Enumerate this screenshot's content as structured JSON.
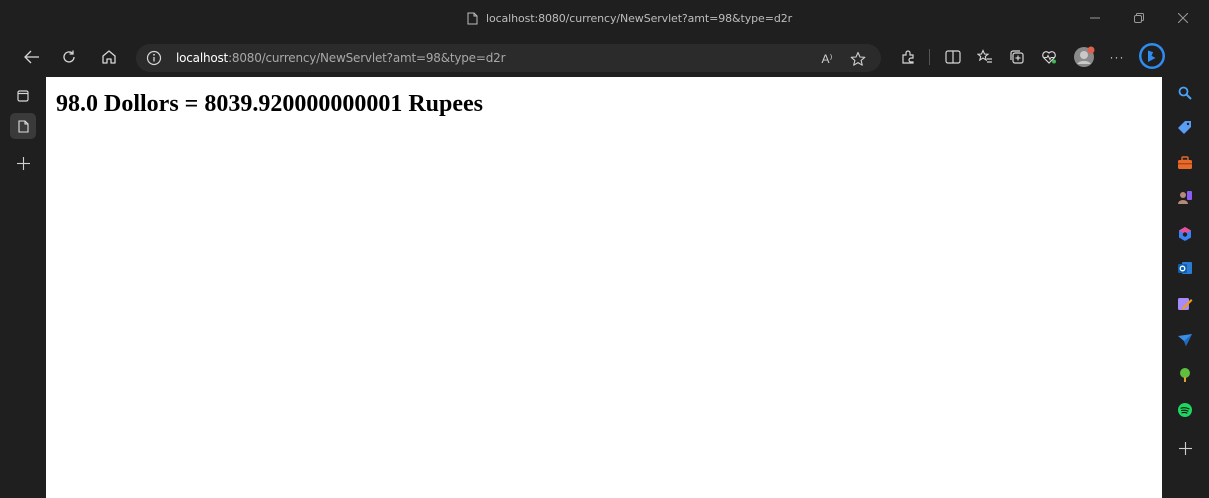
{
  "window": {
    "title": "localhost:8080/currency/NewServlet?amt=98&type=d2r"
  },
  "addressbar": {
    "url_host": "localhost",
    "url_rest": ":8080/currency/NewServlet?amt=98&type=d2r",
    "read_aloud_label": "A⁾"
  },
  "toolbar": {
    "more_label": "···"
  },
  "page": {
    "heading": "98.0 Dollors = 8039.920000000001 Rupees"
  },
  "colors": {
    "chrome_bg": "#1f1f1f",
    "addressbar_bg": "#2b2b2b",
    "page_bg": "#ffffff",
    "bing_blue": "#2f8cf0"
  },
  "sidebar_icons": [
    "search-icon",
    "shopping-tag-icon",
    "tools-icon",
    "games-icon",
    "microsoft-365-icon",
    "outlook-icon",
    "designer-icon",
    "telegram-icon",
    "tree-icon",
    "spotify-icon",
    "add-icon"
  ]
}
